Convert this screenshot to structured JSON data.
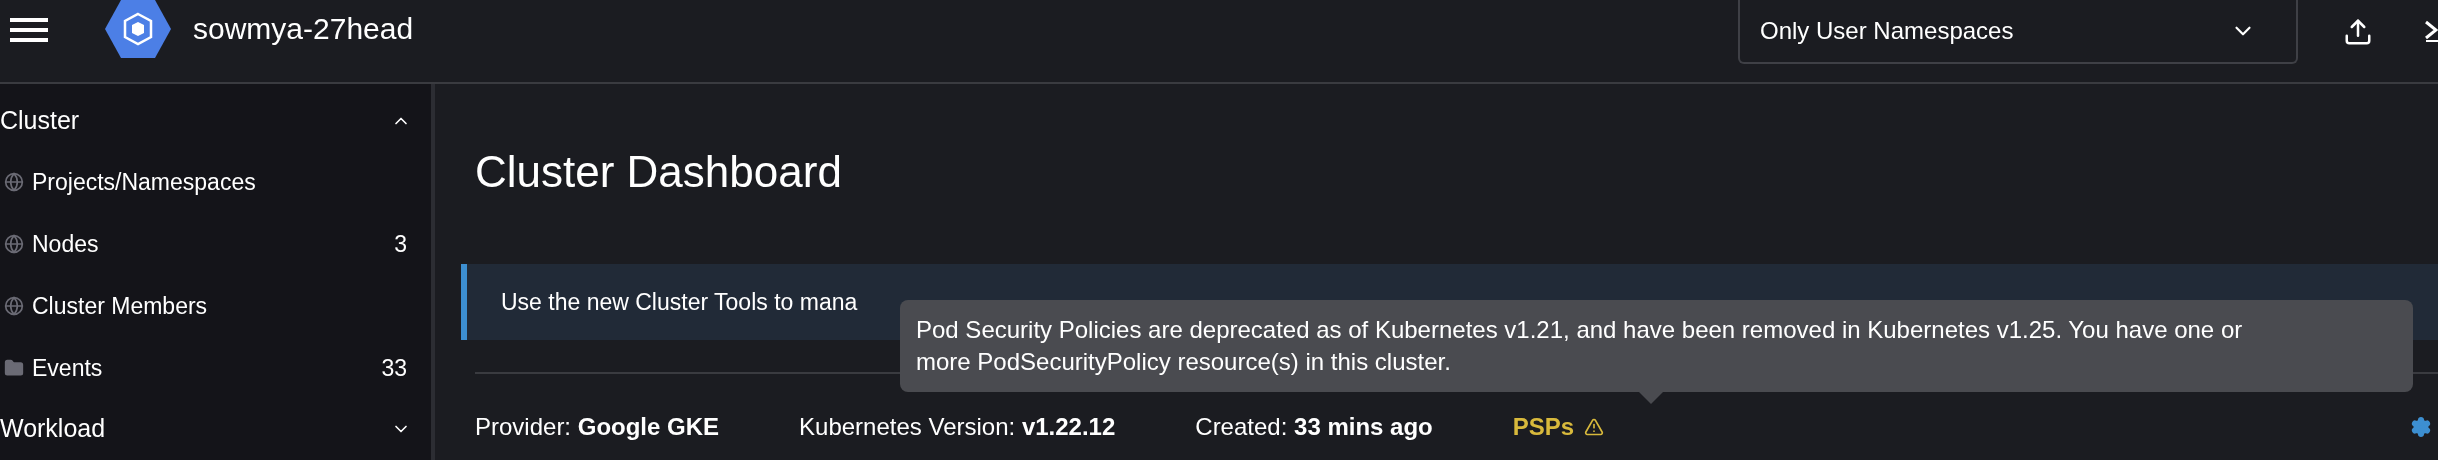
{
  "header": {
    "cluster_name": "sowmya-27head",
    "namespace_filter": {
      "value": "Only User Namespaces"
    }
  },
  "sidebar": {
    "groups": [
      {
        "label": "Cluster",
        "expanded": true,
        "items": [
          {
            "label": "Projects/Namespaces",
            "kind": "globe"
          },
          {
            "label": "Nodes",
            "count": "3",
            "kind": "globe"
          },
          {
            "label": "Cluster Members",
            "kind": "globe"
          },
          {
            "label": "Events",
            "count": "33",
            "kind": "folder"
          }
        ]
      },
      {
        "label": "Workload",
        "expanded": false
      }
    ]
  },
  "page": {
    "title": "Cluster Dashboard",
    "banner": "Use the new Cluster Tools to mana",
    "facts": [
      {
        "label": "Provider:",
        "value": "Google GKE"
      },
      {
        "label": "Kubernetes Version:",
        "value": "v1.22.12"
      },
      {
        "label": "Created:",
        "value": "33 mins ago"
      }
    ],
    "psp": {
      "label": "PSPs",
      "warning": true
    },
    "tooltip": "Pod Security Policies are deprecated as of Kubernetes v1.21, and have been removed in Kubernetes v1.25. You have one or more PodSecurityPolicy resource(s) in this cluster."
  }
}
